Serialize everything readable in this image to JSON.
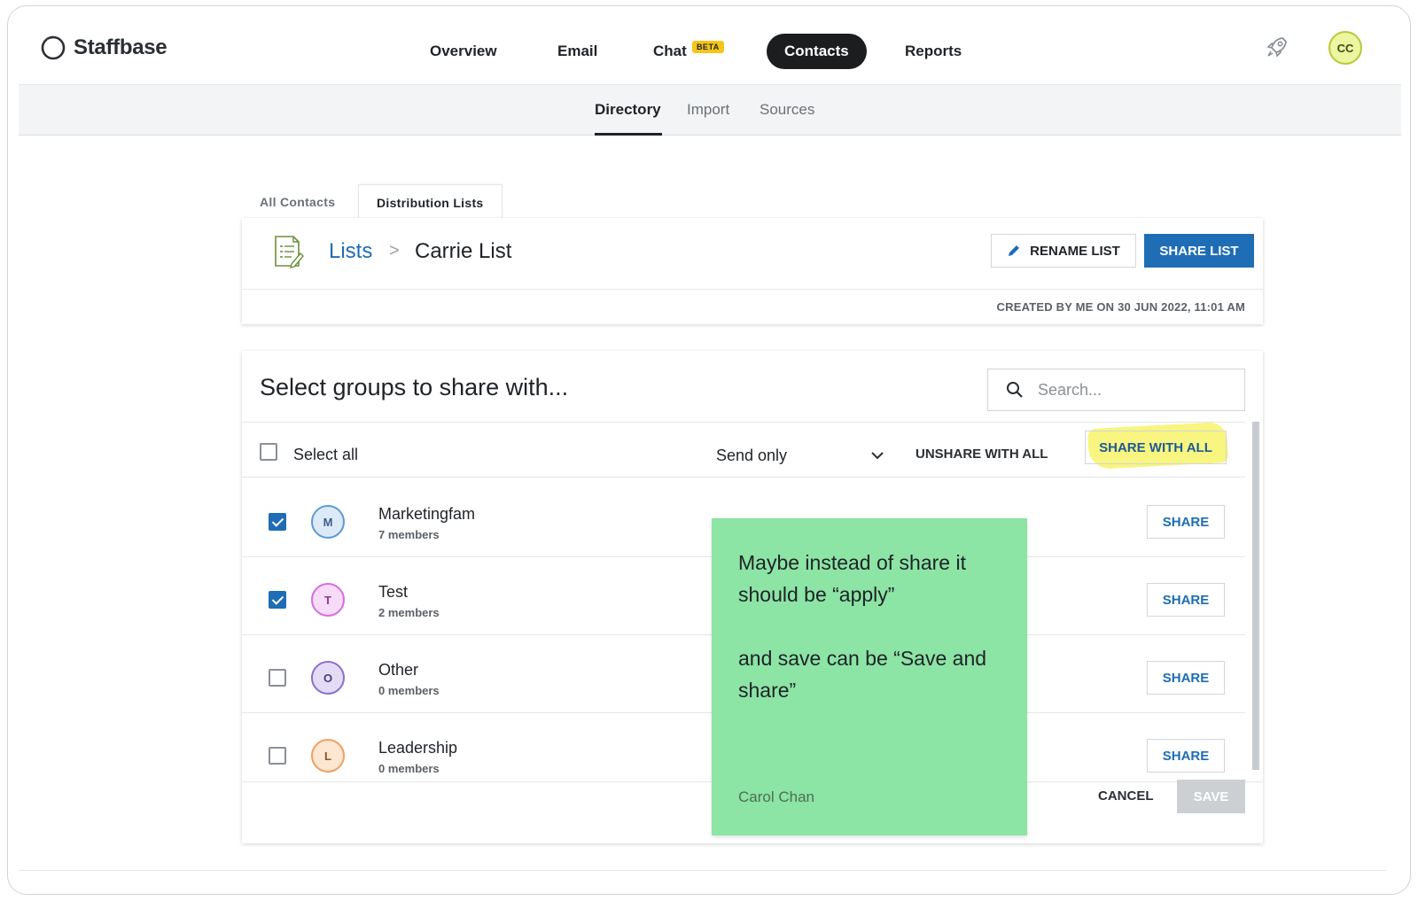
{
  "app": {
    "name": "Staffbase"
  },
  "topnav": {
    "items": [
      {
        "label": "Overview"
      },
      {
        "label": "Email"
      },
      {
        "label": "Chat",
        "badge": "BETA"
      },
      {
        "label": "Contacts",
        "active": true
      },
      {
        "label": "Reports"
      }
    ],
    "user_initials": "CC"
  },
  "subnav": {
    "items": [
      {
        "label": "Directory",
        "active": true
      },
      {
        "label": "Import"
      },
      {
        "label": "Sources"
      }
    ]
  },
  "tabs": [
    {
      "label": "All Contacts"
    },
    {
      "label": "Distribution Lists",
      "active": true
    }
  ],
  "list_header": {
    "breadcrumb_root": "Lists",
    "breadcrumb_sep": ">",
    "list_name": "Carrie List",
    "rename_label": "RENAME LIST",
    "share_label": "SHARE LIST",
    "created_text": "CREATED BY ME ON 30 JUN 2022, 11:01 AM"
  },
  "share_panel": {
    "title": "Select groups to share with...",
    "search_placeholder": "Search...",
    "select_all_label": "Select all",
    "permission_value": "Send only",
    "unshare_all_label": "UNSHARE WITH ALL",
    "share_all_label": "SHARE WITH ALL",
    "groups": [
      {
        "initial": "M",
        "name": "Marketingfam",
        "members": "7 members",
        "checked": true,
        "share_label": "SHARE",
        "color": "#5b9bd5"
      },
      {
        "initial": "T",
        "name": "Test",
        "members": "2 members",
        "checked": true,
        "share_label": "SHARE",
        "color": "#d86be0"
      },
      {
        "initial": "O",
        "name": "Other",
        "members": "0 members",
        "checked": false,
        "share_label": "SHARE",
        "color": "#8a6fd0"
      },
      {
        "initial": "L",
        "name": "Leadership",
        "members": "0 members",
        "checked": false,
        "share_label": "SHARE",
        "color": "#f0a060"
      }
    ],
    "cancel_label": "CANCEL",
    "save_label": "SAVE"
  },
  "sticky_note": {
    "text": "Maybe instead of share it should be “apply”\n\nand save can be “Save and share”",
    "author": "Carol Chan"
  },
  "colors": {
    "accent": "#1e6db5",
    "sticky": "#8ce4a5",
    "highlight": "#f5f03c"
  }
}
